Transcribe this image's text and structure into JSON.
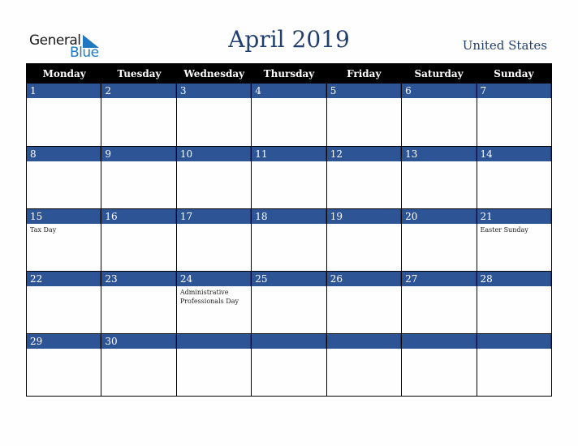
{
  "logo": {
    "line1": "General",
    "line2": "Blue"
  },
  "title": "April 2019",
  "country": "United States",
  "weekdays": [
    "Monday",
    "Tuesday",
    "Wednesday",
    "Thursday",
    "Friday",
    "Saturday",
    "Sunday"
  ],
  "colors": {
    "header_bg": "#000000",
    "date_strip": "#2d5495",
    "title": "#233f6e",
    "logo_blue": "#1f78c1"
  },
  "weeks": [
    [
      {
        "d": "1",
        "e": ""
      },
      {
        "d": "2",
        "e": ""
      },
      {
        "d": "3",
        "e": ""
      },
      {
        "d": "4",
        "e": ""
      },
      {
        "d": "5",
        "e": ""
      },
      {
        "d": "6",
        "e": ""
      },
      {
        "d": "7",
        "e": ""
      }
    ],
    [
      {
        "d": "8",
        "e": ""
      },
      {
        "d": "9",
        "e": ""
      },
      {
        "d": "10",
        "e": ""
      },
      {
        "d": "11",
        "e": ""
      },
      {
        "d": "12",
        "e": ""
      },
      {
        "d": "13",
        "e": ""
      },
      {
        "d": "14",
        "e": ""
      }
    ],
    [
      {
        "d": "15",
        "e": "Tax Day"
      },
      {
        "d": "16",
        "e": ""
      },
      {
        "d": "17",
        "e": ""
      },
      {
        "d": "18",
        "e": ""
      },
      {
        "d": "19",
        "e": ""
      },
      {
        "d": "20",
        "e": ""
      },
      {
        "d": "21",
        "e": "Easter Sunday"
      }
    ],
    [
      {
        "d": "22",
        "e": ""
      },
      {
        "d": "23",
        "e": ""
      },
      {
        "d": "24",
        "e": "Administrative Professionals Day"
      },
      {
        "d": "25",
        "e": ""
      },
      {
        "d": "26",
        "e": ""
      },
      {
        "d": "27",
        "e": ""
      },
      {
        "d": "28",
        "e": ""
      }
    ],
    [
      {
        "d": "29",
        "e": ""
      },
      {
        "d": "30",
        "e": ""
      },
      {
        "d": "",
        "e": ""
      },
      {
        "d": "",
        "e": ""
      },
      {
        "d": "",
        "e": ""
      },
      {
        "d": "",
        "e": ""
      },
      {
        "d": "",
        "e": ""
      }
    ]
  ]
}
